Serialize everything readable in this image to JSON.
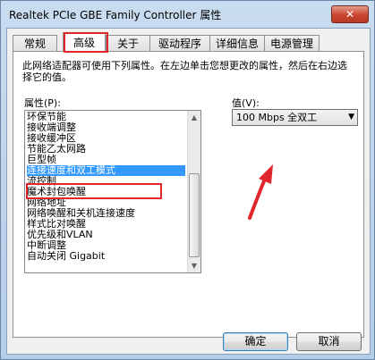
{
  "window": {
    "title": "Realtek PCIe GBE Family Controller 属性",
    "close_symbol": "✕"
  },
  "tabs": [
    {
      "label": "常规"
    },
    {
      "label": "高级"
    },
    {
      "label": "关于"
    },
    {
      "label": "驱动程序"
    },
    {
      "label": "详细信息"
    },
    {
      "label": "电源管理"
    }
  ],
  "panel": {
    "description": "此网络适配器可使用下列属性。在左边单击您想更改的属性，然后在右边选择它的值。",
    "property_label": "属性(P):",
    "value_label": "值(V):",
    "properties": [
      "环保节能",
      "接收端调整",
      "接收缓冲区",
      "节能乙太网路",
      "巨型帧",
      "连接速度和双工模式",
      "流控制",
      "魔术封包唤醒",
      "网络地址",
      "网络唤醒和关机连接速度",
      "样式比对唤醒",
      "优先级和VLAN",
      "中断调整",
      "自动关闭 Gigabit"
    ],
    "selected_index": 5,
    "value_selected": "100 Mbps 全双工",
    "dropdown_arrow": "▼",
    "scroll_up": "▲",
    "scroll_down": "▼"
  },
  "buttons": {
    "ok": "确定",
    "cancel": "取消"
  },
  "colors": {
    "highlight_box": "#e0262a",
    "selection": "#3399ff"
  }
}
